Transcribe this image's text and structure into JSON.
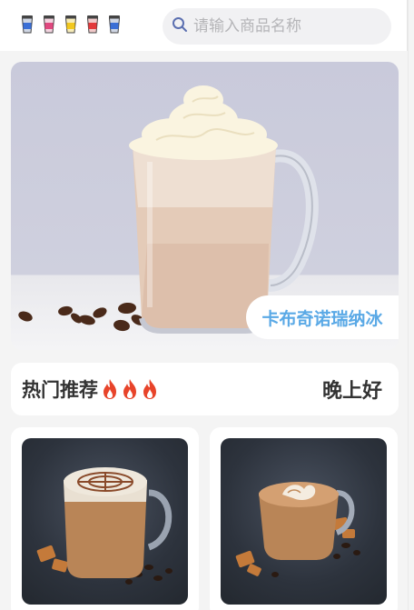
{
  "header": {
    "cup_icons": [
      {
        "name": "cup-icon-blue",
        "color": "#3b6fd6"
      },
      {
        "name": "cup-icon-pink",
        "color": "#e0487f"
      },
      {
        "name": "cup-icon-yellow",
        "color": "#f2c81f"
      },
      {
        "name": "cup-icon-red",
        "color": "#e2393b"
      },
      {
        "name": "cup-icon-blue-2",
        "color": "#3b6fd6"
      }
    ],
    "search": {
      "placeholder": "请输入商品名称",
      "icon": "search-icon"
    }
  },
  "banner": {
    "product_name": "卡布奇诺瑞纳冰",
    "image": "frappuccino-photo"
  },
  "section": {
    "title": "热门推荐",
    "flame_icons": [
      "fire-icon",
      "fire-icon",
      "fire-icon"
    ],
    "greeting": "晚上好"
  },
  "products": [
    {
      "image": "latte-art-mug-photo"
    },
    {
      "image": "latte-cup-photo"
    }
  ],
  "colors": {
    "accent": "#5aa9e6",
    "flame": "#e8442a",
    "text": "#333333"
  }
}
